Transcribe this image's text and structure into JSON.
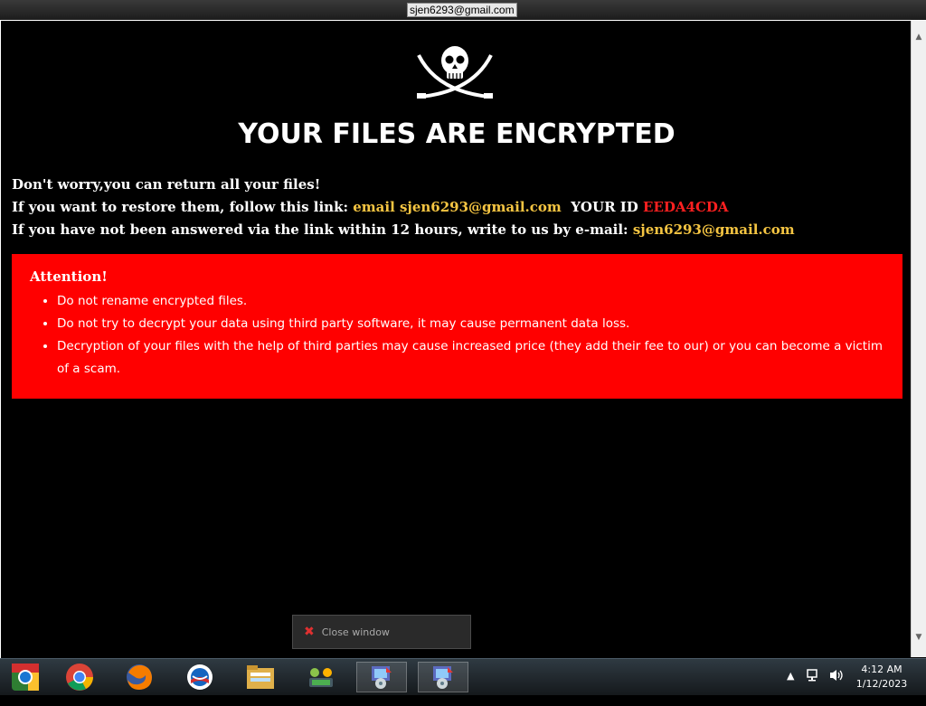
{
  "window": {
    "title": "sjen6293@gmail.com"
  },
  "note": {
    "headline": "YOUR FILES ARE ENCRYPTED",
    "line1": "Don't worry,you can return all your files!",
    "line2_prefix": "If you want to restore them, follow this link:",
    "line2_link": "email sjen6293@gmail.com",
    "line2_id_label": "YOUR ID",
    "line2_id": "EEDA4CDA",
    "line3_prefix": "If you have not been answered via the link within 12 hours, write to us by e-mail:",
    "line3_email": "sjen6293@gmail.com",
    "attention_title": "Attention!",
    "attention_items": [
      "Do not rename encrypted files.",
      "Do not try to decrypt your data using third party software, it may cause permanent data loss.",
      "Decryption of your files with the help of third parties may cause increased price (they add their fee to our) or you can become a victim of a scam."
    ],
    "close_label": "Close window"
  },
  "taskbar": {
    "icons": [
      "chrome-old-icon",
      "chrome-icon",
      "firefox-icon",
      "obama-logo-icon",
      "file-explorer-icon",
      "network-icon",
      "installer-icon",
      "installer-icon"
    ],
    "time": "4:12 AM",
    "date": "1/12/2023"
  },
  "colors": {
    "accent_yellow": "#f5c542",
    "id_red": "#ff2020",
    "banner_red": "#ff0000"
  }
}
